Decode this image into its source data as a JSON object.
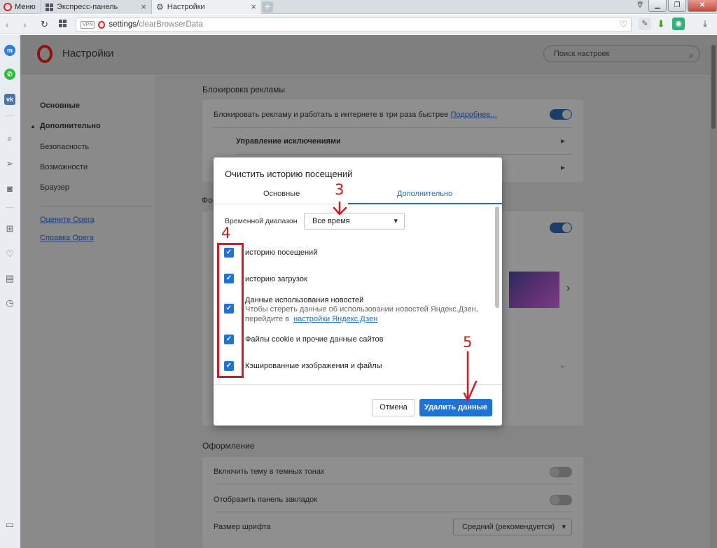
{
  "browser": {
    "menu_label": "Меню",
    "tabs": [
      {
        "label": "Экспресс-панель"
      },
      {
        "label": "Настройки"
      }
    ],
    "address": {
      "prefix": "settings/",
      "path": "clearBrowserData",
      "vpn": "VPN"
    }
  },
  "settings": {
    "title": "Настройки",
    "search_placeholder": "Поиск настроек",
    "nav": {
      "basic": "Основные",
      "advanced": "Дополнительно",
      "security": "Безопасность",
      "features": "Возможности",
      "browser": "Браузер",
      "rate_opera": "Оцените Opera",
      "help_opera": "Справка Opera"
    },
    "ad_block": {
      "title": "Блокировка рекламы",
      "row_text": "Блокировать рекламу и работать в интернете в три раза быстрее",
      "row_link": "Подробнее...",
      "exceptions": "Управление исключениями",
      "toggle_on": true
    },
    "partial_section_letters": "Фо",
    "appearance": {
      "title": "Оформление",
      "dark_theme": "Включить тему в темных тонах",
      "bookmarks_bar": "Отобразить панель закладок",
      "font_size_label": "Размер шрифта",
      "font_size_value": "Средний (рекомендуется)"
    }
  },
  "dialog": {
    "title": "Очистить историю посещений",
    "tab_basic": "Основные",
    "tab_advanced": "Дополнительно",
    "range_label": "Временной диапазон",
    "range_value": "Все время",
    "items": [
      {
        "label": "историю посещений",
        "checked": true
      },
      {
        "label": "историю загрузок",
        "checked": true
      },
      {
        "label": "Данные использования новостей",
        "sub1": "Чтобы стереть данные об использовании новостей Яндекс.Дзен,",
        "sub2": "перейдите в",
        "sub_link": "настройки Яндекс.Дзен",
        "checked": true
      },
      {
        "label": "Файлы cookie и прочие данные сайтов",
        "checked": true
      },
      {
        "label": "Кэшированные изображения и файлы",
        "checked": true
      }
    ],
    "cancel_label": "Отмена",
    "delete_label": "Удалить данные"
  },
  "annotations": {
    "n3": "3",
    "n4": "4",
    "n5": "5",
    "color": "#e0141e"
  },
  "colors": {
    "accent": "#1d73d6",
    "opera_red": "#e2231a"
  }
}
